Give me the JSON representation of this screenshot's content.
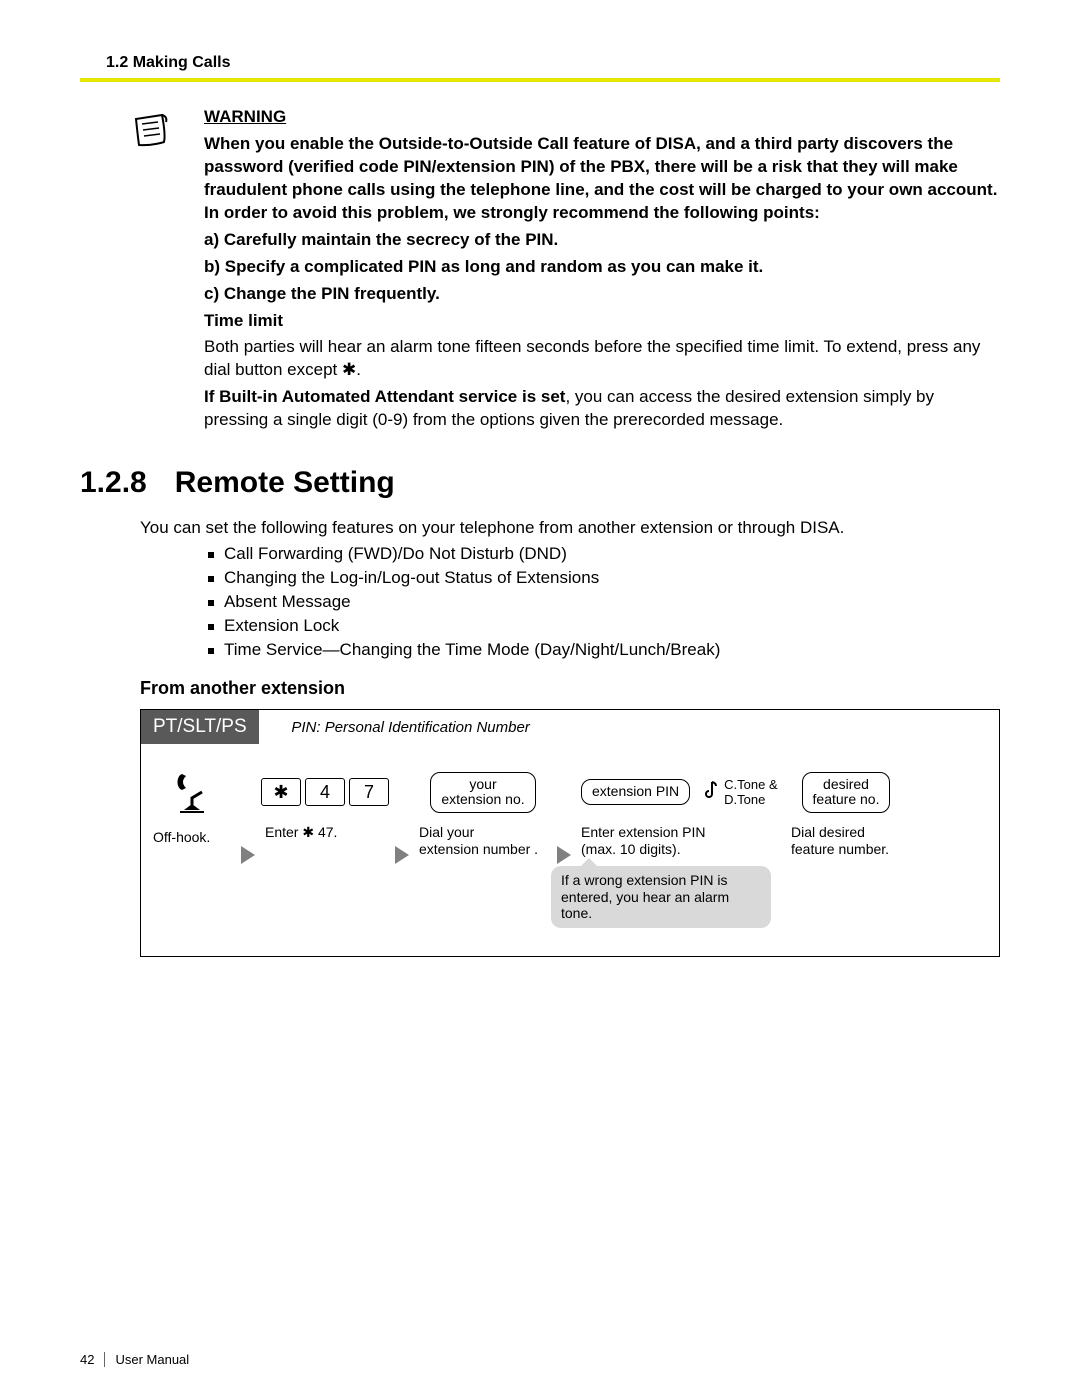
{
  "header": "1.2 Making Calls",
  "warning": {
    "title": "WARNING",
    "body": "When you enable the Outside-to-Outside Call feature of DISA, and a third party discovers the password (verified code PIN/extension PIN) of the PBX, there will be a risk that they will make fraudulent phone calls using the telephone line, and the cost will be charged to your own account. In order to avoid this problem, we strongly recommend the following points:",
    "a": "a) Carefully maintain the secrecy of the PIN.",
    "b": "b) Specify a complicated PIN as long and random as you can make it.",
    "c": "c) Change the PIN frequently.",
    "timelimit_label": "Time limit",
    "timelimit_body": "Both parties will hear an alarm tone fifteen seconds before the specified time limit. To extend, press any dial button except  ✱.",
    "attendant_lead": "If Built-in Automated Attendant service is set",
    "attendant_rest": ", you can access the desired extension simply by pressing a single digit (0-9) from the options given the prerecorded message."
  },
  "section": {
    "number": "1.2.8",
    "title": "Remote Setting",
    "intro": "You can set the following features on your telephone from another extension or through DISA.",
    "features": [
      "Call Forwarding (FWD)/Do Not Disturb (DND)",
      "Changing the Log-in/Log-out Status of Extensions",
      "Absent Message",
      "Extension Lock",
      "Time Service—Changing the Time Mode (Day/Night/Lunch/Break)"
    ]
  },
  "subhead": "From another extension",
  "procedure": {
    "tab": "PT/SLT/PS",
    "caption": "PIN: Personal Identification Number",
    "step1_label": "Off-hook.",
    "keys": {
      "star": "✱",
      "d1": "4",
      "d2": "7"
    },
    "step2_label": "Enter  ✱ 47.",
    "step3_box_l1": "your",
    "step3_box_l2": "extension no.",
    "step3_label": "Dial your\nextension number  .",
    "step4_box": "extension PIN",
    "step4_label": "Enter extension PIN\n(max. 10 digits).",
    "step4_note": "If a wrong extension PIN is\nentered, you hear an alarm tone.",
    "tone_l1": "C.Tone &",
    "tone_l2": "D.Tone",
    "step5_box_l1": "desired",
    "step5_box_l2": "feature no.",
    "step5_label": "Dial desired\nfeature number."
  },
  "footer": {
    "page": "42",
    "title": "User Manual"
  }
}
